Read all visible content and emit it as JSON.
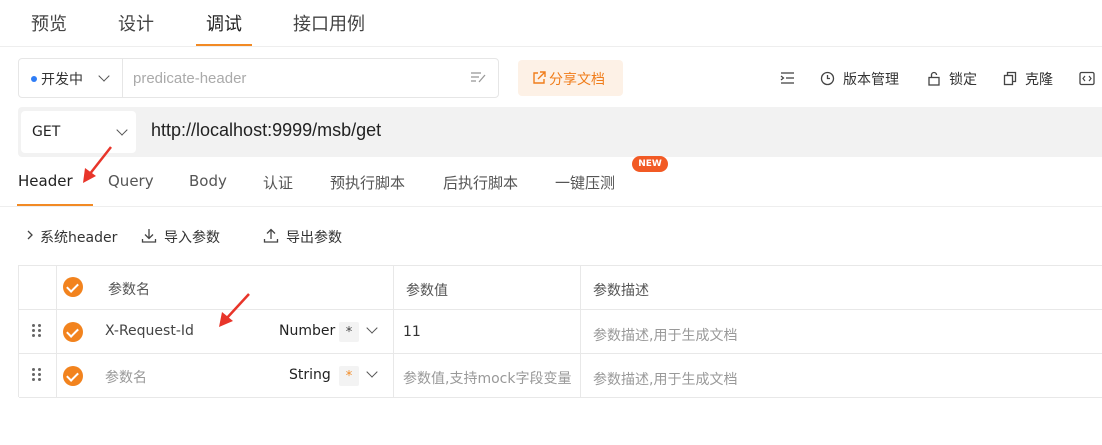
{
  "top_tabs": [
    {
      "label": "预览",
      "active": false
    },
    {
      "label": "设计",
      "active": false
    },
    {
      "label": "调试",
      "active": true
    },
    {
      "label": "接口用例",
      "active": false
    }
  ],
  "env": {
    "label": "开发中",
    "dot_color": "#2f7df6"
  },
  "name_input": {
    "placeholder": "predicate-header"
  },
  "share_button": {
    "label": "分享文档"
  },
  "toolbar": {
    "version_label": "版本管理",
    "lock_label": "锁定",
    "clone_label": "克隆"
  },
  "request": {
    "method": "GET",
    "url": "http://localhost:9999/msb/get"
  },
  "req_tabs": [
    {
      "label": "Header",
      "active": true
    },
    {
      "label": "Query",
      "active": false
    },
    {
      "label": "Body",
      "active": false
    },
    {
      "label": "认证",
      "active": false
    },
    {
      "label": "预执行脚本",
      "active": false
    },
    {
      "label": "后执行脚本",
      "active": false
    },
    {
      "label": "一键压测",
      "active": false
    }
  ],
  "new_badge": "NEW",
  "actions": {
    "system_header": "系统header",
    "import": "导入参数",
    "export": "导出参数"
  },
  "table": {
    "headers": {
      "name": "参数名",
      "value": "参数值",
      "desc": "参数描述"
    },
    "rows": [
      {
        "name": "X-Request-Id",
        "type": "Number",
        "required": "*",
        "value": "11",
        "desc": "参数描述,用于生成文档",
        "name_is_placeholder": false,
        "value_is_placeholder": false
      },
      {
        "name": "参数名",
        "type": "String",
        "required": "*",
        "value": "参数值,支持mock字段变量",
        "desc": "参数描述,用于生成文档",
        "name_is_placeholder": true,
        "value_is_placeholder": true
      }
    ]
  },
  "colors": {
    "accent": "#f28a24",
    "badge": "#f25a24",
    "annotation_arrow": "#e8352a"
  }
}
